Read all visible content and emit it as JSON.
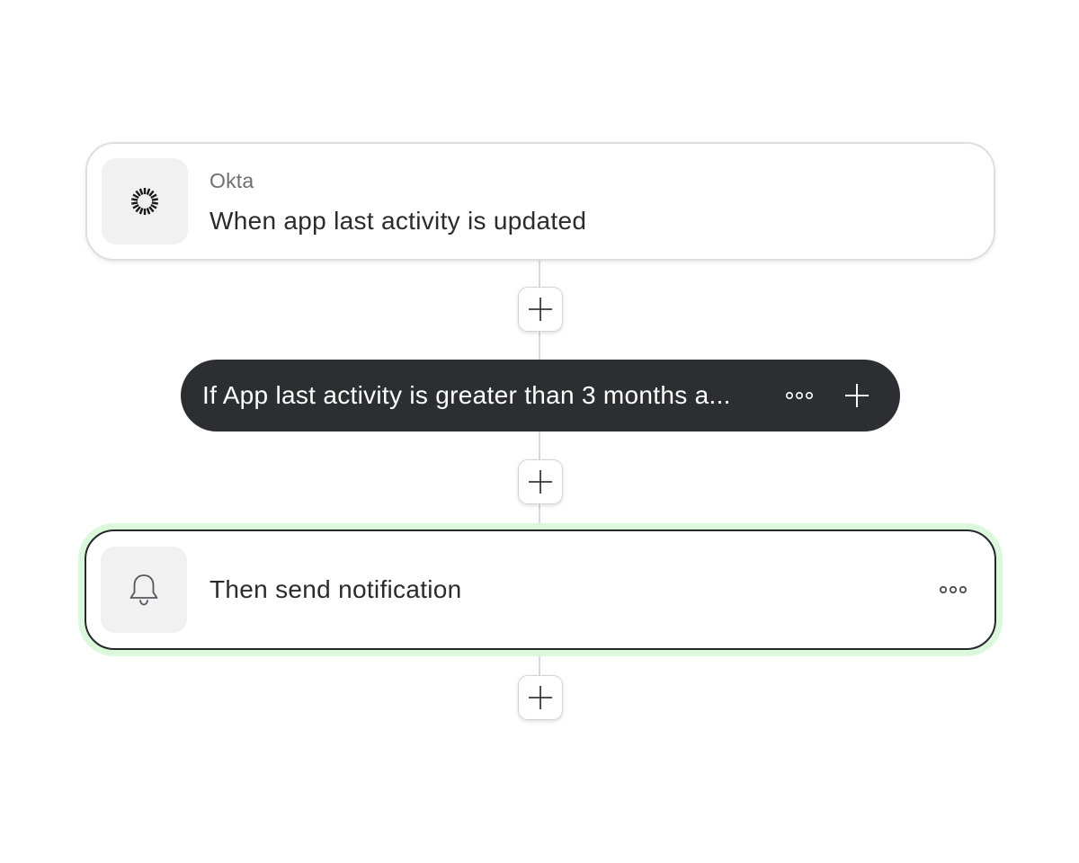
{
  "workflow": {
    "trigger": {
      "app_name": "Okta",
      "title": "When app last activity is updated",
      "icon": "okta-logo-icon"
    },
    "condition": {
      "text": "If App last activity is greater than 3 months a...",
      "more_icon": "more-options-icon",
      "add_icon": "plus-icon"
    },
    "action": {
      "title": "Then send notification",
      "icon": "bell-icon",
      "more_icon": "more-options-icon"
    }
  },
  "colors": {
    "condition_background": "#2d2e32",
    "selected_glow": "#dcf8dc",
    "connector": "#d9d9d9"
  }
}
